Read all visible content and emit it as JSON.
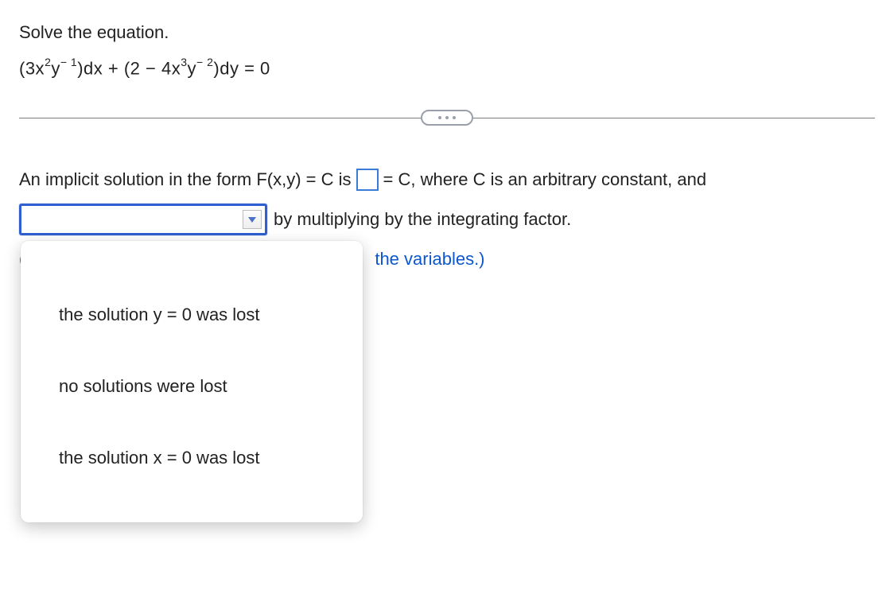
{
  "question": {
    "prompt": "Solve the equation.",
    "equation_html": "(3x<sup>2</sup>y<sup>− 1</sup>)dx + (2 − 4x<sup>3</sup>y<sup>− 2</sup>)dy = 0"
  },
  "answer": {
    "line1_a": "An implicit solution in the form F(x,y) = C is ",
    "line1_b": " = C, where C is an arbitrary constant, and",
    "line2_b": " by multiplying by the integrating factor.",
    "line3_paren": "(",
    "line3_hint": "the variables.)"
  },
  "dropdown": {
    "selected": "",
    "options": [
      "the solution y = 0 was lost",
      "no solutions were lost",
      "the solution x = 0 was lost"
    ]
  }
}
